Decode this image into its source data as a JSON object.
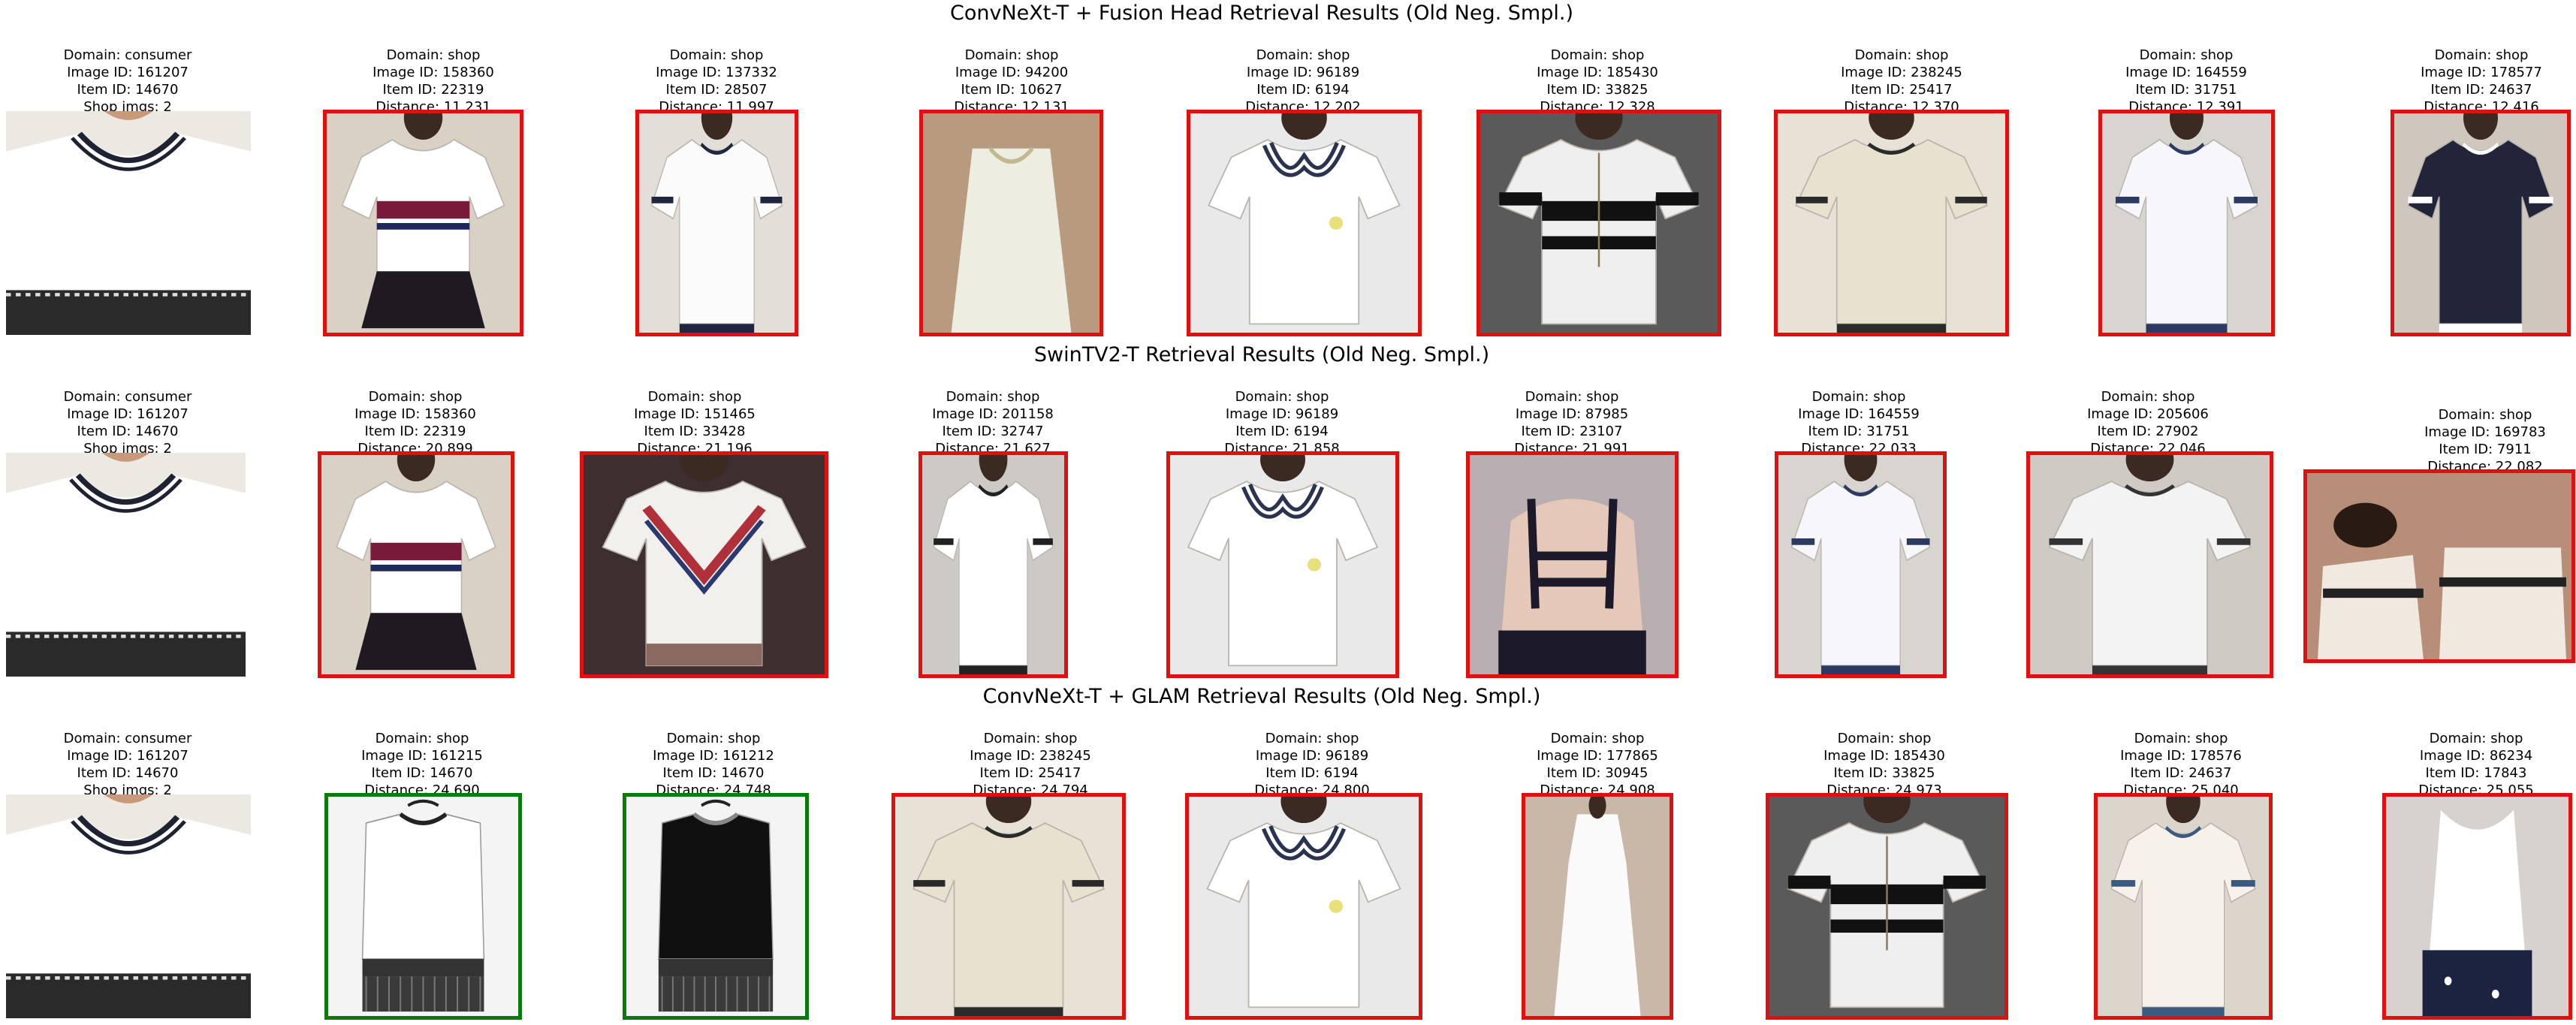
{
  "rows": [
    {
      "title": "ConvNeXt-T + Fusion Head Retrieval Results (Old Neg. Smpl.)",
      "items": [
        {
          "lines": [
            "Domain: consumer",
            "Image ID: 161207",
            "Item ID: 14670",
            "Shop imgs: 2"
          ],
          "border": "none",
          "bg": "#ece8e2",
          "shirt": "#ffffff",
          "accent": "#1e2233",
          "style": "query"
        },
        {
          "lines": [
            "Domain: shop",
            "Image ID: 158360",
            "Item ID: 22319",
            "Distance: 11.231"
          ],
          "border": "red",
          "bg": "#d9d1c4",
          "shirt": "#ffffff",
          "accent": "#7a1a3a",
          "style": "stripe"
        },
        {
          "lines": [
            "Domain: shop",
            "Image ID: 137332",
            "Item ID: 28507",
            "Distance: 11.997"
          ],
          "border": "red",
          "bg": "#e3ded8",
          "shirt": "#fbfbfb",
          "accent": "#1f2640",
          "style": "plain"
        },
        {
          "lines": [
            "Domain: shop",
            "Image ID: 94200",
            "Item ID: 10627",
            "Distance: 12.131"
          ],
          "border": "red",
          "bg": "#b89a7f",
          "shirt": "#eeede2",
          "accent": "#b89a7f",
          "style": "halter"
        },
        {
          "lines": [
            "Domain: shop",
            "Image ID: 96189",
            "Item ID: 6194",
            "Distance: 12.202"
          ],
          "border": "red",
          "bg": "#e9e9ea",
          "shirt": "#ffffff",
          "accent": "#2a3350",
          "style": "collar"
        },
        {
          "lines": [
            "Domain: shop",
            "Image ID: 185430",
            "Item ID: 33825",
            "Distance: 12.328"
          ],
          "border": "red",
          "bg": "#5a5a5a",
          "shirt": "#efefef",
          "accent": "#111111",
          "style": "bands"
        },
        {
          "lines": [
            "Domain: shop",
            "Image ID: 238245",
            "Item ID: 25417",
            "Distance: 12.370"
          ],
          "border": "red",
          "bg": "#e7e1d6",
          "shirt": "#e9e1cf",
          "accent": "#2a2a2a",
          "style": "plain"
        },
        {
          "lines": [
            "Domain: shop",
            "Image ID: 164559",
            "Item ID: 31751",
            "Distance: 12.391"
          ],
          "border": "red",
          "bg": "#d8d4d0",
          "shirt": "#f7f7fb",
          "accent": "#2b3a60",
          "style": "plain"
        },
        {
          "lines": [
            "Domain: shop",
            "Image ID: 178577",
            "Item ID: 24637",
            "Distance: 12.416"
          ],
          "border": "red",
          "bg": "#cfc7bd",
          "shirt": "#22243a",
          "accent": "#ffffff",
          "style": "plain"
        }
      ]
    },
    {
      "title": "SwinTV2-T Retrieval Results (Old Neg. Smpl.)",
      "items": [
        {
          "lines": [
            "Domain: consumer",
            "Image ID: 161207",
            "Item ID: 14670",
            "Shop imgs: 2"
          ],
          "border": "none",
          "bg": "#ece8e2",
          "shirt": "#ffffff",
          "accent": "#1e2233",
          "style": "query"
        },
        {
          "lines": [
            "Domain: shop",
            "Image ID: 158360",
            "Item ID: 22319",
            "Distance: 20.899"
          ],
          "border": "red",
          "bg": "#d9d1c4",
          "shirt": "#ffffff",
          "accent": "#7a1a3a",
          "style": "stripe"
        },
        {
          "lines": [
            "Domain: shop",
            "Image ID: 151465",
            "Item ID: 33428",
            "Distance: 21.196"
          ],
          "border": "red",
          "bg": "#3d2f2f",
          "shirt": "#f2f0ec",
          "accent": "#b0303a",
          "style": "chevron"
        },
        {
          "lines": [
            "Domain: shop",
            "Image ID: 201158",
            "Item ID: 32747",
            "Distance: 21.627"
          ],
          "border": "red",
          "bg": "#cdc9c4",
          "shirt": "#ffffff",
          "accent": "#222222",
          "style": "plain"
        },
        {
          "lines": [
            "Domain: shop",
            "Image ID: 96189",
            "Item ID: 6194",
            "Distance: 21.858"
          ],
          "border": "red",
          "bg": "#e9e9ea",
          "shirt": "#ffffff",
          "accent": "#2a3350",
          "style": "collar"
        },
        {
          "lines": [
            "Domain: shop",
            "Image ID: 87985",
            "Item ID: 23107",
            "Distance: 21.991"
          ],
          "border": "red",
          "bg": "#b8aeb2",
          "shirt": "#1c1a2a",
          "accent": "#1c1a2a",
          "style": "straps"
        },
        {
          "lines": [
            "Domain: shop",
            "Image ID: 164559",
            "Item ID: 31751",
            "Distance: 22.033"
          ],
          "border": "red",
          "bg": "#d8d4d0",
          "shirt": "#f7f7fb",
          "accent": "#2b3a60",
          "style": "plain"
        },
        {
          "lines": [
            "Domain: shop",
            "Image ID: 205606",
            "Item ID: 27902",
            "Distance: 22.046"
          ],
          "border": "red",
          "bg": "#cfcac4",
          "shirt": "#f3f3f3",
          "accent": "#333333",
          "style": "plain"
        },
        {
          "lines": [
            "Domain: shop",
            "Image ID: 169783",
            "Item ID: 7911",
            "Distance: 22.082"
          ],
          "border": "red",
          "bg": "#b78f78",
          "shirt": "#efe9e0",
          "accent": "#222222",
          "style": "couple"
        }
      ]
    },
    {
      "title": "ConvNeXt-T + GLAM Retrieval Results (Old Neg. Smpl.)",
      "items": [
        {
          "lines": [
            "Domain: consumer",
            "Image ID: 161207",
            "Item ID: 14670",
            "Shop imgs: 2"
          ],
          "border": "none",
          "bg": "#ece8e2",
          "shirt": "#ffffff",
          "accent": "#1e2233",
          "style": "query"
        },
        {
          "lines": [
            "Domain: shop",
            "Image ID: 161215",
            "Item ID: 14670",
            "Distance: 24.690"
          ],
          "border": "green",
          "bg": "#f4f4f4",
          "shirt": "#ffffff",
          "accent": "#1c1c1c",
          "style": "fringe"
        },
        {
          "lines": [
            "Domain: shop",
            "Image ID: 161212",
            "Item ID: 14670",
            "Distance: 24.748"
          ],
          "border": "green",
          "bg": "#f4f4f4",
          "shirt": "#101010",
          "accent": "#bfbfbf",
          "style": "fringe"
        },
        {
          "lines": [
            "Domain: shop",
            "Image ID: 238245",
            "Item ID: 25417",
            "Distance: 24.794"
          ],
          "border": "red",
          "bg": "#e7e1d6",
          "shirt": "#e9e1cf",
          "accent": "#2a2a2a",
          "style": "plain"
        },
        {
          "lines": [
            "Domain: shop",
            "Image ID: 96189",
            "Item ID: 6194",
            "Distance: 24.800"
          ],
          "border": "red",
          "bg": "#e9e9ea",
          "shirt": "#ffffff",
          "accent": "#2a3350",
          "style": "collar"
        },
        {
          "lines": [
            "Domain: shop",
            "Image ID: 177865",
            "Item ID: 30945",
            "Distance: 24.908"
          ],
          "border": "red",
          "bg": "#c9b7a7",
          "shirt": "#fafafa",
          "accent": "#fafafa",
          "style": "dress"
        },
        {
          "lines": [
            "Domain: shop",
            "Image ID: 185430",
            "Item ID: 33825",
            "Distance: 24.973"
          ],
          "border": "red",
          "bg": "#5a5a5a",
          "shirt": "#efefef",
          "accent": "#111111",
          "style": "bands"
        },
        {
          "lines": [
            "Domain: shop",
            "Image ID: 178576",
            "Item ID: 24637",
            "Distance: 25.040"
          ],
          "border": "red",
          "bg": "#dcd5cc",
          "shirt": "#f6f2ea",
          "accent": "#3a5a80",
          "style": "plain"
        },
        {
          "lines": [
            "Domain: shop",
            "Image ID: 86234",
            "Item ID: 17843",
            "Distance: 25.055"
          ],
          "border": "red",
          "bg": "#d7d2cd",
          "shirt": "#ffffff",
          "accent": "#1b2340",
          "style": "tank"
        }
      ]
    }
  ]
}
